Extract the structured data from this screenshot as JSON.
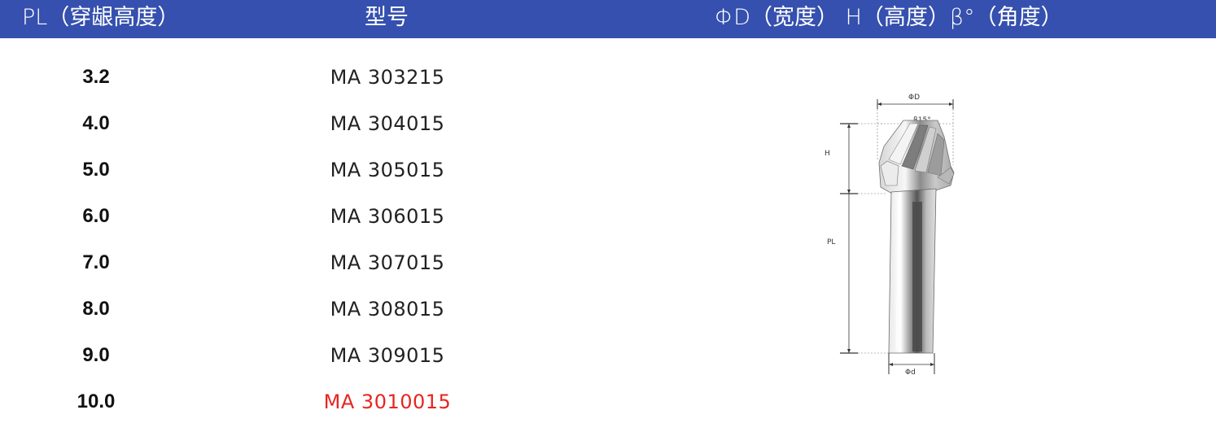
{
  "header": {
    "pl_label": "PL（穿龈高度）",
    "model_label": "型号",
    "dims_label": "ΦD（宽度） H（高度）β°（角度）"
  },
  "rows": [
    {
      "pl": "3.2",
      "model": "MA 303215"
    },
    {
      "pl": "4.0",
      "model": "MA 304015"
    },
    {
      "pl": "5.0",
      "model": "MA 305015"
    },
    {
      "pl": "6.0",
      "model": "MA 306015"
    },
    {
      "pl": "7.0",
      "model": "MA 307015"
    },
    {
      "pl": "8.0",
      "model": "MA 308015"
    },
    {
      "pl": "9.0",
      "model": "MA 309015"
    },
    {
      "pl": "10.0",
      "model": "MA 3010015"
    }
  ],
  "drawing": {
    "label_D": "ΦD",
    "label_H": "H",
    "label_PL": "PL",
    "label_beta": "β15°",
    "label_d": "Φd"
  },
  "colors": {
    "header_bg": "#3550ae",
    "highlight_text": "#e8251f"
  }
}
